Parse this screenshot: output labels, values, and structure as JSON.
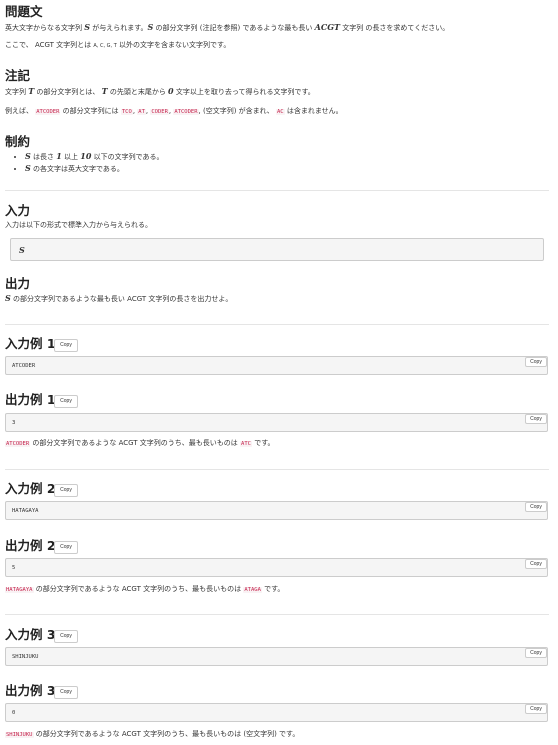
{
  "statement": {
    "title": "問題文",
    "line1_a": "英大文字からなる文字列 ",
    "var_s": "S",
    "line1_b": " が与えられます。",
    "line1_c": " の部分文字列 (注記を参照) であるような最も長い ",
    "acgt_math": "ACGT",
    "line1_d": " 文字列 の長さを求めてください。",
    "line2_a": "ここで、 ACGT 文字列とは ",
    "letters": "A, C, G, T",
    "line2_b": " 以外の文字を含まない文字列です。"
  },
  "notes": {
    "title": "注記",
    "line1_a": "文字列 ",
    "var_t": "T",
    "line1_b": " の部分文字列とは、 ",
    "line1_c": " の先頭と末尾から ",
    "zero": "0",
    "line1_d": " 文字以上を取り去って得られる文字列です。",
    "line2_a": "例えば、 ",
    "example": "ATCODER",
    "line2_b": " の部分文字列には ",
    "sub1": "TCO",
    "sub2": "AT",
    "sub3": "CODER",
    "sub4": "ATCODER",
    "line2_c": ", (空文字列) が含まれ、 ",
    "not_sub": "AC",
    "line2_d": " は含まれません。",
    "sep": ", "
  },
  "constraints": {
    "title": "制約",
    "item1_a": " は長さ ",
    "one": "1",
    "item1_b": " 以上 ",
    "ten": "10",
    "item1_c": " 以下の文字列である。",
    "item2": " の各文字は英大文字である。"
  },
  "input": {
    "title": "入力",
    "desc": "入力は以下の形式で標準入力から与えられる。",
    "format": "S"
  },
  "output": {
    "title": "出力",
    "desc": " の部分文字列であるような最も長い ACGT 文字列の長さを出力せよ。"
  },
  "copy_label": "Copy",
  "samples": [
    {
      "in_title": "入力例 1",
      "in_value": "ATCODER",
      "out_title": "出力例 1",
      "out_value": "3",
      "expl_word": "ATCODER",
      "expl_mid": " の部分文字列であるような ACGT 文字列のうち、最も長いものは ",
      "expl_ans": "ATC",
      "expl_end": " です。"
    },
    {
      "in_title": "入力例 2",
      "in_value": "HATAGAYA",
      "out_title": "出力例 2",
      "out_value": "5",
      "expl_word": "HATAGAYA",
      "expl_mid": " の部分文字列であるような ACGT 文字列のうち、最も長いものは ",
      "expl_ans": "ATAGA",
      "expl_end": " です。"
    },
    {
      "in_title": "入力例 3",
      "in_value": "SHINJUKU",
      "out_title": "出力例 3",
      "out_value": "0",
      "expl_word": "SHINJUKU",
      "expl_mid": " の部分文字列であるような ACGT 文字列のうち、最も長いものは (空文字列) です。"
    }
  ]
}
